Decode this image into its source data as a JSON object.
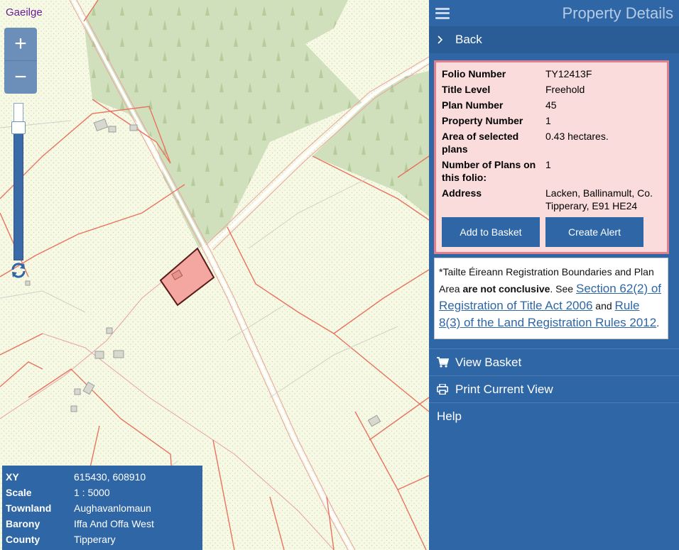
{
  "map": {
    "language_link": "Gaeilge",
    "zoom_in_label": "+",
    "zoom_out_label": "−",
    "info": [
      {
        "key": "XY",
        "value": "615430, 608910"
      },
      {
        "key": "Scale",
        "value": "1 : 5000"
      },
      {
        "key": "Townland",
        "value": "Aughavanlomaun"
      },
      {
        "key": "Barony",
        "value": "Iffa And Offa West"
      },
      {
        "key": "County",
        "value": "Tipperary"
      }
    ]
  },
  "panel": {
    "title": "Property Details",
    "back_label": "Back",
    "details": {
      "folio_label": "Folio Number",
      "folio_value": "TY12413F",
      "title_level_label": "Title Level",
      "title_level_value": "Freehold",
      "plan_label": "Plan Number",
      "plan_value": "45",
      "property_label": "Property Number",
      "property_value": "1",
      "area_label": "Area of selected plans",
      "area_value": "0.43 hectares.",
      "num_plans_label": "Number of Plans on this folio:",
      "num_plans_value": "1",
      "address_label": "Address",
      "address_value": "Lacken, Ballinamult, Co. Tipperary, E91 HE24",
      "add_basket_label": "Add to Basket",
      "create_alert_label": "Create Alert"
    },
    "note": {
      "prefix": "*Tailte Éireann Registration Boundaries and Plan Area ",
      "emphasis": "are not conclusive",
      "middle": ". See ",
      "link1": "Section 62(2) of Registration of Title Act 2006",
      "and_text": " and ",
      "link2": "Rule 8(3) of the Land Registration Rules 2012",
      "suffix": "."
    },
    "view_basket_label": "View Basket",
    "print_label": "Print Current View",
    "help_label": "Help"
  },
  "colors": {
    "panel_blue": "#2f66a5",
    "highlight_red": "#e37f8c",
    "boundary_red": "#e8735e",
    "forest_green": "#c9dbb3"
  },
  "icons": [
    "chevron-right-icon",
    "cart-icon",
    "printer-icon",
    "hamburger-icon",
    "refresh-icon"
  ]
}
